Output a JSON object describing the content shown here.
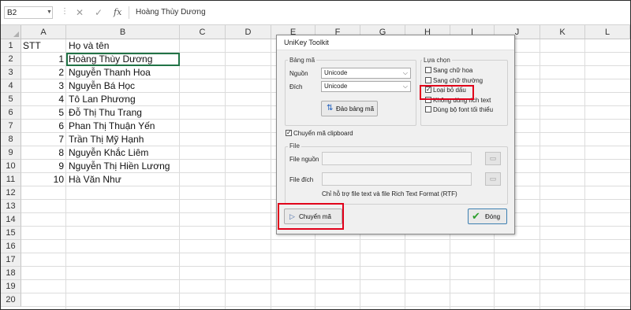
{
  "formula_bar": {
    "name_box": "B2",
    "cancel_symbol": "✕",
    "enter_symbol": "✓",
    "fx_symbol": "fx",
    "content": "Hoàng Thùy Dương"
  },
  "columns": [
    "A",
    "B",
    "C",
    "D",
    "E",
    "F",
    "G",
    "H",
    "I",
    "J",
    "K",
    "L"
  ],
  "rows": [
    "1",
    "2",
    "3",
    "4",
    "5",
    "6",
    "7",
    "8",
    "9",
    "10",
    "11",
    "12",
    "13",
    "14",
    "15",
    "16",
    "17",
    "18",
    "19",
    "20"
  ],
  "sheet": {
    "header": {
      "stt": "STT",
      "name": "Họ và tên"
    },
    "data": [
      {
        "stt": "1",
        "name": "Hoàng Thùy Dương"
      },
      {
        "stt": "2",
        "name": "Nguyễn Thanh Hoa"
      },
      {
        "stt": "3",
        "name": "Nguyễn Bá Học"
      },
      {
        "stt": "4",
        "name": "Tô Lan Phương"
      },
      {
        "stt": "5",
        "name": "Đỗ Thị Thu Trang"
      },
      {
        "stt": "6",
        "name": "Phan Thị Thuận Yến"
      },
      {
        "stt": "7",
        "name": "Trần Thị Mỹ Hạnh"
      },
      {
        "stt": "8",
        "name": "Nguyễn Khắc Liêm"
      },
      {
        "stt": "9",
        "name": "Nguyễn Thị Hiền Lương"
      },
      {
        "stt": "10",
        "name": "Hà Văn Như"
      }
    ]
  },
  "dialog": {
    "title": "UniKey Toolkit",
    "bang_ma": {
      "group_label": "Bảng mã",
      "source_label": "Nguồn",
      "source_value": "Unicode",
      "dest_label": "Đích",
      "dest_value": "Unicode",
      "swap_button": "Đảo bảng mã"
    },
    "options": {
      "group_label": "Lựa chọn",
      "items": [
        {
          "label": "Sang chữ hoa",
          "checked": false
        },
        {
          "label": "Sang chữ thường",
          "checked": false
        },
        {
          "label": "Loại bỏ dấu",
          "checked": true
        },
        {
          "label": "Không dùng rich text",
          "checked": false
        },
        {
          "label": "Dùng bộ font tối thiểu",
          "checked": false
        }
      ]
    },
    "clipboard": {
      "label": "Chuyển mã clipboard",
      "checked": true
    },
    "file": {
      "group_label": "File",
      "source_label": "File nguồn",
      "dest_label": "File đích",
      "note": "Chỉ hỗ trợ file text và file Rich Text Format (RTF)"
    },
    "convert_button": "Chuyển mã",
    "close_button": "Đóng",
    "highlight_color": "#e1001a"
  }
}
